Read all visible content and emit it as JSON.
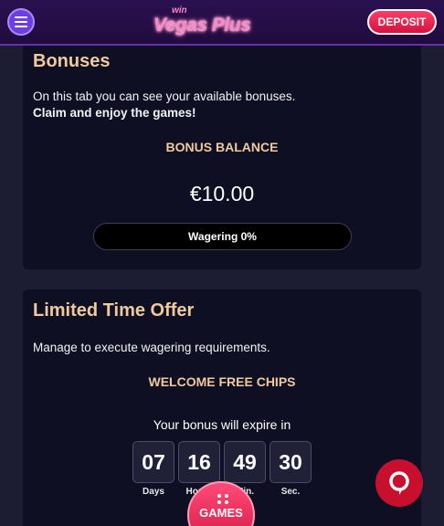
{
  "header": {
    "logo_small": "win",
    "logo_main": "Vegas Plus",
    "deposit_label": "DEPOSIT"
  },
  "bonuses": {
    "title": "Bonuses",
    "desc_line1": "On this tab you can see your available bonuses.",
    "desc_line2": "Claim and enjoy the games!",
    "balance_label": "BONUS BALANCE",
    "balance_value": "€10.00",
    "wagering_label": "Wagering 0%",
    "wagering_fraction": 0
  },
  "offer": {
    "title": "Limited Time Offer",
    "desc": "Manage to execute wagering requirements.",
    "subhead": "WELCOME FREE CHIPS",
    "expire_text": "Your bonus will expire in",
    "timer": [
      {
        "value": "07",
        "label": "Days"
      },
      {
        "value": "16",
        "label": "Hours"
      },
      {
        "value": "49",
        "label": "Min."
      },
      {
        "value": "30",
        "label": "Sec."
      }
    ]
  },
  "games_label": "GAMES",
  "colors": {
    "accent_gold": "#f0c99c",
    "brand_red": "#d3123f",
    "menu_purple": "#6e3fe0"
  },
  "icons": {
    "menu": "hamburger-icon",
    "chat": "chat-bubble-icon",
    "games": "dots-icon"
  }
}
